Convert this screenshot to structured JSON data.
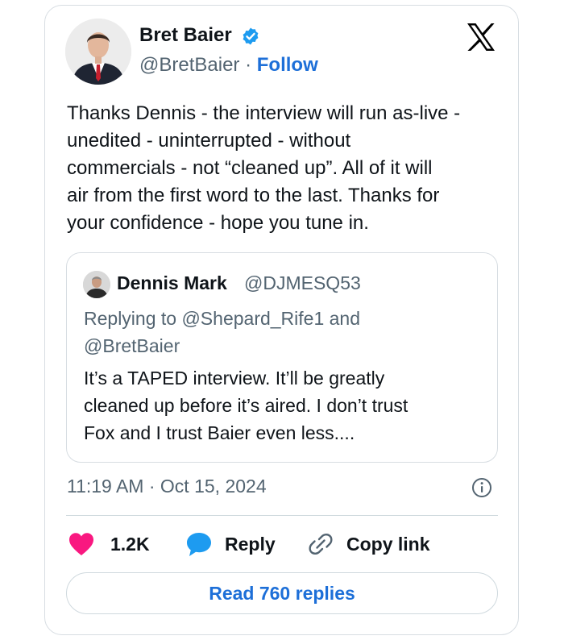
{
  "author": {
    "name": "Bret Baier",
    "handle": "@BretBaier",
    "separator": "·",
    "follow_label": "Follow"
  },
  "tweet": {
    "text": "Thanks Dennis - the interview will run as-live -\nunedited - uninterrupted - without\ncommercials - not “cleaned up”.   All of it will\nair from the first word to the last.  Thanks for\nyour confidence - hope you tune in.",
    "timestamp": "11:19 AM · Oct 15, 2024"
  },
  "quoted_tweet": {
    "name": "Dennis Mark",
    "handle": "@DJMESQ53",
    "replying_to": "Replying to @Shepard_Rife1 and\n@BretBaier",
    "text": "It’s a TAPED interview. It’ll be greatly\ncleaned up before it’s aired. I don’t trust\nFox and I trust Baier even less...."
  },
  "actions": {
    "likes_count": "1.2K",
    "reply_label": "Reply",
    "copy_link_label": "Copy link",
    "read_replies_label": "Read 760 replies"
  },
  "icons": {
    "verified": "verified-badge-icon",
    "logo": "x-logo-icon",
    "info": "info-icon",
    "like": "heart-icon",
    "reply": "speech-bubble-icon",
    "copy": "link-icon"
  },
  "colors": {
    "accent": "#1d6fd8",
    "like": "#f91880",
    "reply": "#1d9bf0",
    "muted": "#536471",
    "border": "#d7dde2"
  }
}
